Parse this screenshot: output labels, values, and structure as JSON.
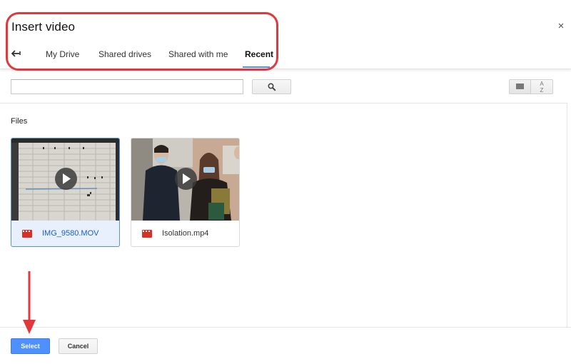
{
  "dialog": {
    "title": "Insert video",
    "close_symbol": "×"
  },
  "tabs": [
    {
      "label": "My Drive",
      "active": false
    },
    {
      "label": "Shared drives",
      "active": false
    },
    {
      "label": "Shared with me",
      "active": false
    },
    {
      "label": "Recent",
      "active": true
    }
  ],
  "toolbar": {
    "search_value": "",
    "search_icon": "magnifier-icon",
    "view_icon": "list-view-icon",
    "sort_label": "A Z"
  },
  "files_section": {
    "label": "Files",
    "items": [
      {
        "name": "IMG_9580.MOV",
        "selected": true,
        "icon": "video-file-icon"
      },
      {
        "name": "Isolation.mp4",
        "selected": false,
        "icon": "video-file-icon"
      }
    ]
  },
  "footer": {
    "select_label": "Select",
    "cancel_label": "Cancel"
  },
  "colors": {
    "accent": "#4d90fe",
    "annotation": "#e2383d",
    "file_icon": "#d93025"
  }
}
